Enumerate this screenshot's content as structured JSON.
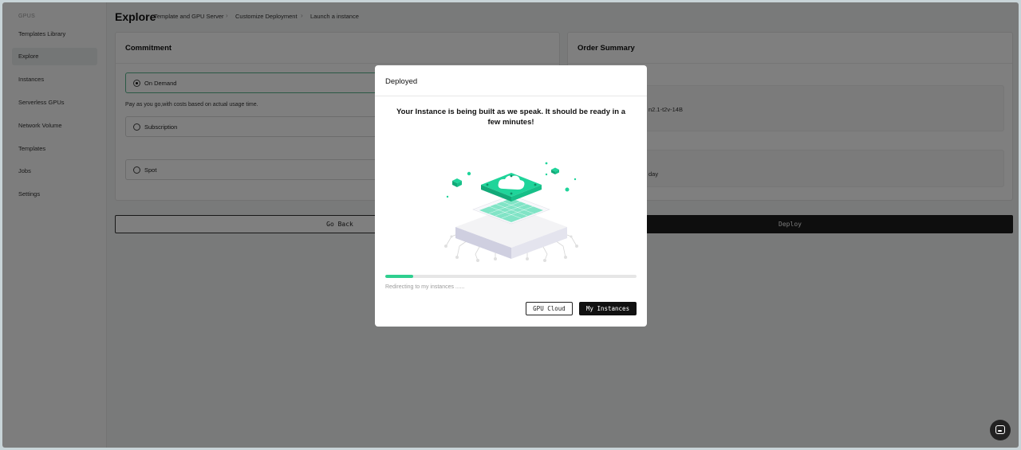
{
  "sidebar": {
    "section_label": "GPUS",
    "items": [
      {
        "label": "Templates Library"
      },
      {
        "label": "Explore"
      },
      {
        "label": "Instances"
      },
      {
        "label": "Serverless GPUs"
      },
      {
        "label": "Network Volume"
      },
      {
        "label": "Templates"
      },
      {
        "label": "Jobs"
      },
      {
        "label": "Settings"
      }
    ],
    "active_item": "Explore"
  },
  "header": {
    "title": "Explore",
    "breadcrumbs": [
      "Template and GPU Server",
      "Customize Deployment",
      "Launch a instance"
    ]
  },
  "commitment": {
    "title": "Commitment",
    "options": [
      {
        "label": "On Demand",
        "selected": true
      },
      {
        "label": "Subscription",
        "selected": false
      },
      {
        "label": "Spot",
        "selected": false
      }
    ],
    "on_demand_description": "Pay as you go,with costs based on actual usage time."
  },
  "order_summary": {
    "title": "Order Summary",
    "partial_line_1": "n2.1-t2v-14B",
    "partial_line_2": "day"
  },
  "actions": {
    "go_back_label": "Go Back",
    "deploy_label": "Deploy"
  },
  "modal": {
    "title": "Deployed",
    "message": "Your Instance is being built as we speak. It should be ready in a few minutes!",
    "progress_fraction": 0.11,
    "redirect_text": "Redirecting to my instances ......",
    "gpu_cloud_label": "GPU Cloud",
    "my_instances_label": "My Instances",
    "illustration_icon": "cloud-chip-icon"
  },
  "colors": {
    "accent": "#2ecf8f",
    "chip_green": "#1fd49a",
    "dark_button": "#111111",
    "overlay": "rgba(0,0,0,0.5)"
  },
  "chat_icon": "chat-icon"
}
